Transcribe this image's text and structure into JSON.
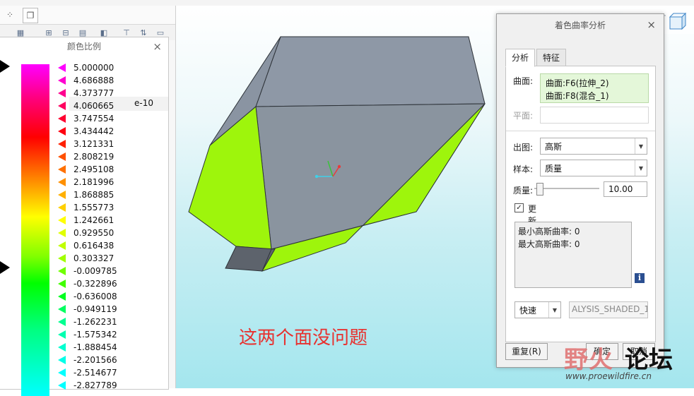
{
  "color_scale": {
    "title": "颜色比例",
    "top_value": "5.000000",
    "exponent": "e-10",
    "values": [
      "4.686888",
      "4.373777",
      "4.060665",
      "3.747554",
      "3.434442",
      "3.121331",
      "2.808219",
      "2.495108",
      "2.181996",
      "1.868885",
      "1.555773",
      "1.242661",
      "0.929550",
      "0.616438",
      "0.303327",
      "-0.009785",
      "-0.322896",
      "-0.636008",
      "-0.949119",
      "-1.262231",
      "-1.575342",
      "-1.888454",
      "-2.201566",
      "-2.514677",
      "-2.827789"
    ],
    "marker_colors": [
      "#ff00ff",
      "#ff00d0",
      "#ff0090",
      "#ff0060",
      "#ff0030",
      "#ff0010",
      "#ff2000",
      "#ff5000",
      "#ff7000",
      "#ff9000",
      "#ffb000",
      "#ffd000",
      "#ffff00",
      "#e0ff00",
      "#c0ff00",
      "#a0ff00",
      "#70ff00",
      "#40ff00",
      "#00ff20",
      "#00ff60",
      "#00ff90",
      "#00ffb0",
      "#00ffd0",
      "#00ffe8",
      "#00ffff",
      "#00ffff"
    ]
  },
  "annotation": "这两个面没问题",
  "dialog": {
    "title": "着色曲率分析",
    "tabs": [
      {
        "label": "分析"
      },
      {
        "label": "特征"
      }
    ],
    "surface_label": "曲面:",
    "surfaces": [
      "曲面:F6(拉伸_2)",
      "曲面:F8(混合_1)"
    ],
    "plane_label": "平面:",
    "output_label": "出图:",
    "output_value": "高斯",
    "sample_label": "样本:",
    "sample_value": "质量",
    "quality_label": "质量:",
    "quality_value": "10.00",
    "quality_fraction": 0.08,
    "update_label": "更新",
    "update_checked": "✓",
    "result_lines": [
      "最小高斯曲率: 0",
      "最大高斯曲率: 0"
    ],
    "mode_value": "快速",
    "name_value": "ALYSIS_SHADED_1",
    "reset_label": "重复(R)",
    "ok_label": "确定",
    "cancel_label": "取消"
  },
  "watermark": {
    "brand_left": "野火",
    "brand_right": "论坛",
    "url": "www.proewildfire.cn"
  },
  "colors": {
    "face_gray": "#8d97a5",
    "face_green": "#9df90a",
    "annotation": "#e8312f"
  }
}
